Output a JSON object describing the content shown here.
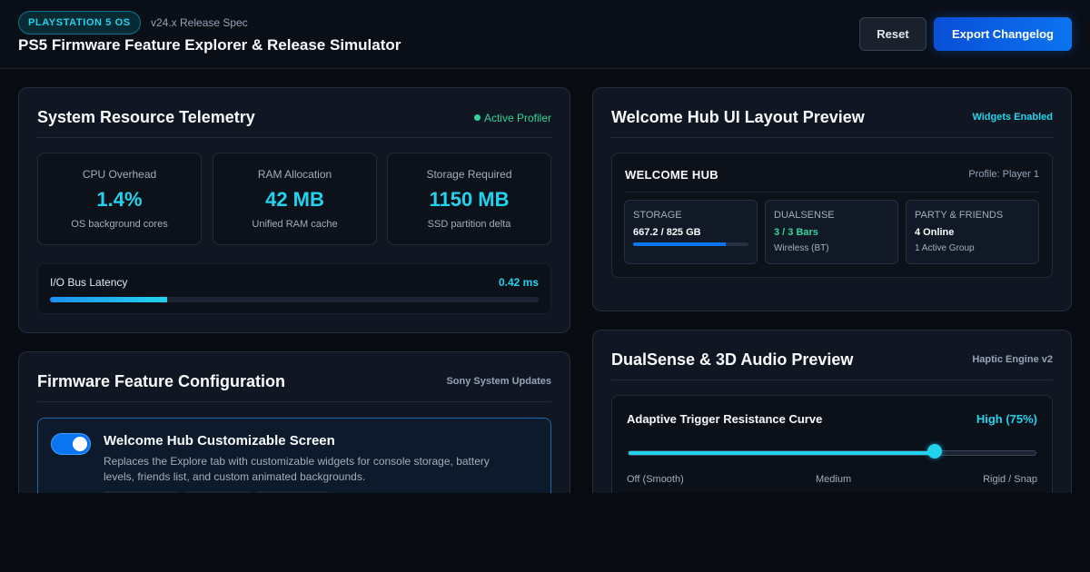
{
  "header": {
    "os_badge": "PLAYSTATION 5 OS",
    "release_spec": "v24.x Release Spec",
    "title": "PS5 Firmware Feature Explorer & Release Simulator",
    "reset_label": "Reset",
    "export_label": "Export Changelog"
  },
  "telemetry": {
    "title": "System Resource Telemetry",
    "status": "Active Profiler",
    "metrics": [
      {
        "label": "CPU Overhead",
        "value": "1.4%",
        "sub": "OS background cores"
      },
      {
        "label": "RAM Allocation",
        "value": "42 MB",
        "sub": "Unified RAM cache"
      },
      {
        "label": "Storage Required",
        "value": "1150 MB",
        "sub": "SSD partition delta"
      }
    ],
    "latency": {
      "label": "I/O Bus Latency",
      "value": "0.42 ms",
      "fill_fraction": 0.24
    }
  },
  "firmware": {
    "title": "Firmware Feature Configuration",
    "tag": "Sony System Updates",
    "feature": {
      "enabled": true,
      "title": "Welcome Hub Customizable Screen",
      "description": "Replaces the Explore tab with customizable widgets for console storage, battery levels, friends list, and custom animated backgrounds."
    }
  },
  "welcome": {
    "title": "Welcome Hub UI Layout Preview",
    "tag": "Widgets Enabled",
    "hub_title": "WELCOME HUB",
    "profile": "Profile: Player 1",
    "widgets": [
      {
        "label": "STORAGE",
        "value": "667.2 / 825 GB",
        "fill_fraction": 0.8
      },
      {
        "label": "DUALSENSE",
        "value": "3 / 3 Bars",
        "sub": "Wireless (BT)"
      },
      {
        "label": "PARTY & FRIENDS",
        "value": "4 Online",
        "sub": "1 Active Group"
      }
    ]
  },
  "audio": {
    "title": "DualSense & 3D Audio Preview",
    "tag": "Haptic Engine v2",
    "trigger_label": "Adaptive Trigger Resistance Curve",
    "trigger_value": "High (75%)",
    "trigger_level": 0.75,
    "scale": {
      "low": "Off (Smooth)",
      "mid": "Medium",
      "high": "Rigid / Snap"
    }
  },
  "colors": {
    "accent_cyan": "#22d3ee",
    "accent_blue": "#0b74f0",
    "status_green": "#34d399",
    "background": "#080b12"
  }
}
